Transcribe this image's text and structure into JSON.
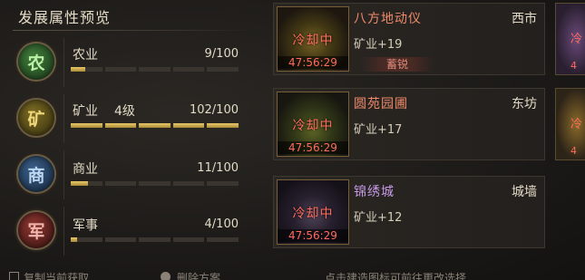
{
  "panel": {
    "title": "发展属性预览"
  },
  "attributes": [
    {
      "badge": "农",
      "name": "农业",
      "level": "",
      "value": "9/100",
      "progress": 0.09
    },
    {
      "badge": "矿",
      "name": "矿业",
      "level": "4级",
      "value": "102/100",
      "progress": 1.0
    },
    {
      "badge": "商",
      "name": "商业",
      "level": "",
      "value": "11/100",
      "progress": 0.11
    },
    {
      "badge": "军",
      "name": "军事",
      "level": "",
      "value": "4/100",
      "progress": 0.04
    }
  ],
  "cards": [
    {
      "name": "八方地动仪",
      "location": "西市",
      "bonus": "矿业+19",
      "cooldown": "冷却中",
      "timer": "47:56:29",
      "tag": "蓄锐"
    },
    {
      "name": "圆苑园圃",
      "location": "东坊",
      "bonus": "矿业+17",
      "cooldown": "冷却中",
      "timer": "47:56:29",
      "tag": ""
    },
    {
      "name": "锦绣城",
      "location": "城墙",
      "bonus": "矿业+12",
      "cooldown": "冷却中",
      "timer": "47:56:29",
      "tag": ""
    }
  ],
  "side_cards": [
    {
      "cooldown": "冷",
      "timer": "4"
    },
    {
      "cooldown": "冷",
      "timer": "4"
    }
  ],
  "bottom": {
    "left_text": "复制当前获取",
    "mid_text": "删除方案",
    "right_text": "点击建造图标可前往更改选择"
  },
  "colors": {
    "accent_red": "#ff6b5e",
    "card_name": "#f08a6a",
    "gold_fill": "#e9c86a"
  }
}
